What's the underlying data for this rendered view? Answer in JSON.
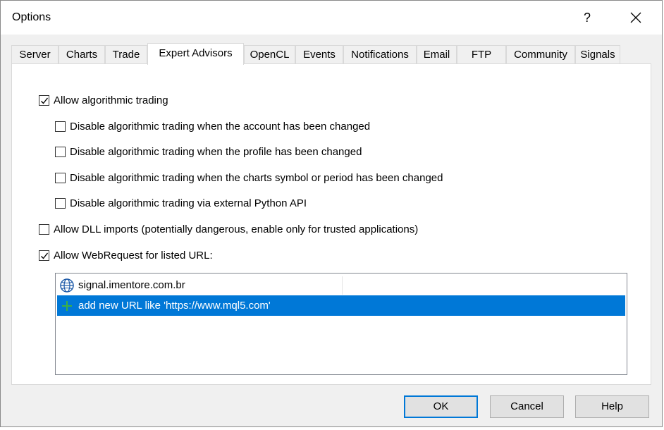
{
  "window": {
    "title": "Options",
    "help_label": "?"
  },
  "tabs": [
    {
      "label": "Server",
      "active": false
    },
    {
      "label": "Charts",
      "active": false
    },
    {
      "label": "Trade",
      "active": false
    },
    {
      "label": "Expert Advisors",
      "active": true
    },
    {
      "label": "OpenCL",
      "active": false
    },
    {
      "label": "Events",
      "active": false
    },
    {
      "label": "Notifications",
      "active": false
    },
    {
      "label": "Email",
      "active": false
    },
    {
      "label": "FTP",
      "active": false
    },
    {
      "label": "Community",
      "active": false
    },
    {
      "label": "Signals",
      "active": false
    }
  ],
  "options": {
    "allow_algo": {
      "label": "Allow algorithmic trading",
      "checked": true
    },
    "disable_account": {
      "label": "Disable algorithmic trading when the account has been changed",
      "checked": false
    },
    "disable_profile": {
      "label": "Disable algorithmic trading when the profile has been changed",
      "checked": false
    },
    "disable_symbol": {
      "label": "Disable algorithmic trading when the charts symbol or period has been changed",
      "checked": false
    },
    "disable_python": {
      "label": "Disable algorithmic trading via external Python API",
      "checked": false
    },
    "allow_dll": {
      "label": "Allow DLL imports (potentially dangerous, enable only for trusted applications)",
      "checked": false
    },
    "allow_webrequest": {
      "label": "Allow WebRequest for listed URL:",
      "checked": true
    }
  },
  "url_list": {
    "items": [
      {
        "url": "signal.imentore.com.br",
        "icon": "globe-icon"
      }
    ],
    "add_new_label": "add new URL like 'https://www.mql5.com'",
    "add_icon": "plus-icon",
    "selection_color": "#0078d7"
  },
  "buttons": {
    "ok": "OK",
    "cancel": "Cancel",
    "help": "Help"
  },
  "colors": {
    "accent": "#0078d7",
    "plus_green": "#3cb043"
  }
}
